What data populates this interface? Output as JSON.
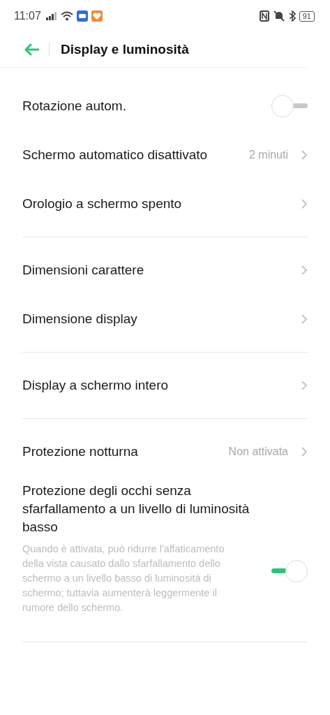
{
  "status_bar": {
    "time": "11:07",
    "battery": "91"
  },
  "header": {
    "title": "Display e luminosità"
  },
  "sections": [
    {
      "items": [
        {
          "kind": "toggle",
          "label": "Rotazione autom.",
          "on": false
        },
        {
          "kind": "link",
          "label": "Schermo automatico disattivato",
          "value": "2 minuti"
        },
        {
          "kind": "link",
          "label": "Orologio a schermo spento"
        }
      ]
    },
    {
      "items": [
        {
          "kind": "link",
          "label": "Dimensioni carattere"
        },
        {
          "kind": "link",
          "label": "Dimensione display"
        }
      ]
    },
    {
      "items": [
        {
          "kind": "link",
          "label": "Display a schermo intero"
        }
      ]
    },
    {
      "items": [
        {
          "kind": "link",
          "label": "Protezione notturna",
          "value": "Non attivata"
        },
        {
          "kind": "toggle",
          "label": "Protezione degli occhi senza sfarfallamento a un livello di luminosità basso",
          "description": "Quando è attivata, può ridurre l'affaticamento della vista causato dallo sfarfallamento dello schermo a un livello basso di luminosità di schermo; tuttavia aumenterà leggermente il rumore dello schermo.",
          "on": true
        }
      ]
    }
  ]
}
